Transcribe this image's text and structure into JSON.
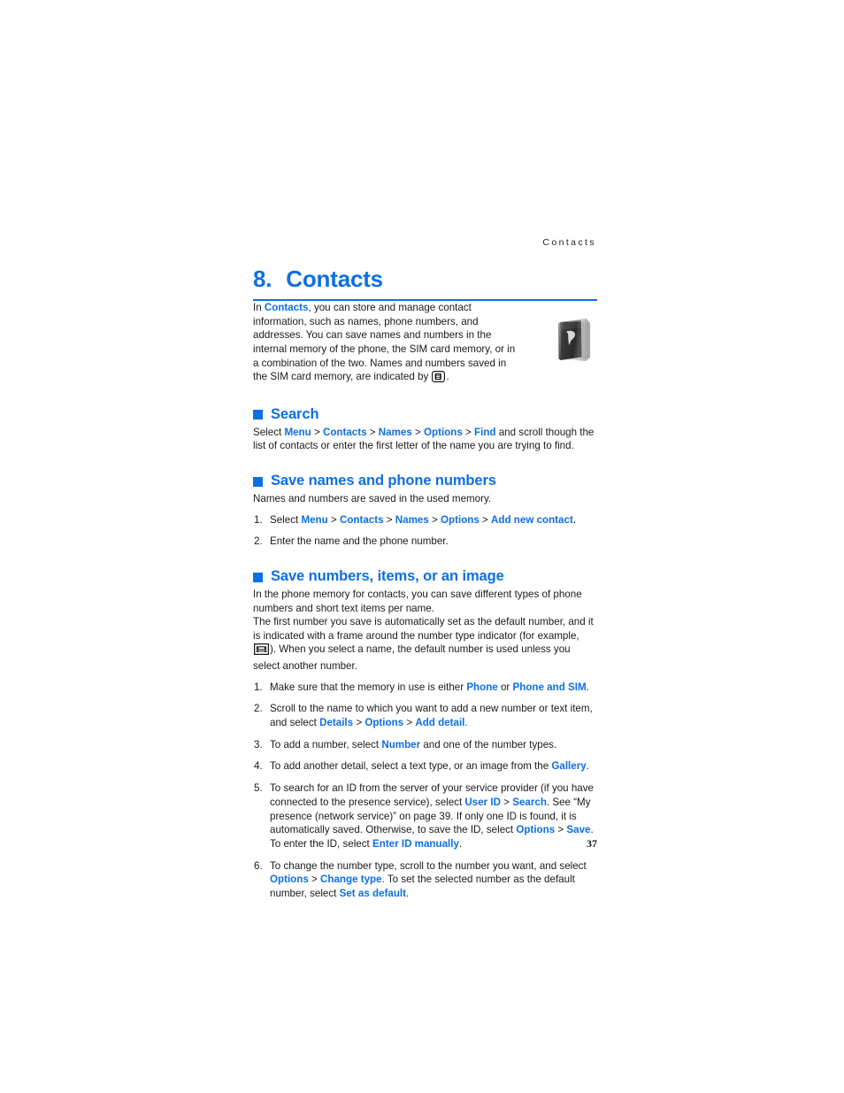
{
  "page": {
    "running_header": "Contacts",
    "page_number": "37",
    "accent_color": "#0d6fe3",
    "text_color": "#1a1a1a"
  },
  "chapter": {
    "number": "8.",
    "title": "Contacts"
  },
  "intro": {
    "segments": [
      {
        "t": "In ",
        "s": "plain"
      },
      {
        "t": "Contacts",
        "s": "blue"
      },
      {
        "t": ", you can store and manage contact information, such as names, phone numbers, and addresses. You can save names and numbers in the internal memory of the phone, the SIM card memory, or in a combination of the two. Names and numbers saved in the SIM card memory, are indicated by ",
        "s": "plain"
      },
      {
        "t": "sim-card-icon",
        "s": "icon"
      },
      {
        "t": ".",
        "s": "plain"
      }
    ],
    "illustration": "contacts-book-icon"
  },
  "sections": [
    {
      "id": "search",
      "heading": "Search",
      "paragraphs": [
        {
          "segments": [
            {
              "t": "Select ",
              "s": "plain"
            },
            {
              "t": "Menu",
              "s": "blue"
            },
            {
              "t": " > ",
              "s": "gt"
            },
            {
              "t": "Contacts",
              "s": "blue"
            },
            {
              "t": " > ",
              "s": "gt"
            },
            {
              "t": "Names",
              "s": "blue"
            },
            {
              "t": " > ",
              "s": "gt"
            },
            {
              "t": "Options",
              "s": "blue"
            },
            {
              "t": " > ",
              "s": "gt"
            },
            {
              "t": "Find",
              "s": "blue"
            },
            {
              "t": " and scroll though the list of contacts or enter the first letter of the name you are trying to find.",
              "s": "plain"
            }
          ]
        }
      ],
      "steps": []
    },
    {
      "id": "save-names-and-phone-numbers",
      "heading": "Save names and phone numbers",
      "paragraphs": [
        {
          "segments": [
            {
              "t": "Names and numbers are saved in the used memory.",
              "s": "plain"
            }
          ]
        }
      ],
      "steps": [
        {
          "num": "1.",
          "segments": [
            {
              "t": "Select ",
              "s": "plain"
            },
            {
              "t": "Menu",
              "s": "blue"
            },
            {
              "t": " > ",
              "s": "gt"
            },
            {
              "t": "Contacts",
              "s": "blue"
            },
            {
              "t": " > ",
              "s": "gt"
            },
            {
              "t": "Names",
              "s": "blue"
            },
            {
              "t": " > ",
              "s": "gt"
            },
            {
              "t": "Options",
              "s": "blue"
            },
            {
              "t": " > ",
              "s": "gt"
            },
            {
              "t": "Add new contact",
              "s": "blue"
            },
            {
              "t": ".",
              "s": "plain"
            }
          ]
        },
        {
          "num": "2.",
          "segments": [
            {
              "t": "Enter the name and the phone number.",
              "s": "plain"
            }
          ]
        }
      ]
    },
    {
      "id": "save-numbers-items-or-an-image",
      "heading": "Save numbers, items, or an image",
      "paragraphs": [
        {
          "segments": [
            {
              "t": "In the phone memory for contacts, you can save different types of phone numbers and short text items per name.",
              "s": "plain"
            }
          ]
        },
        {
          "segments": [
            {
              "t": "The first number you save is automatically set as the default number, and it is indicated with a frame around the number type indicator (for example, ",
              "s": "plain"
            },
            {
              "t": "default-phone-number-icon",
              "s": "icon"
            },
            {
              "t": "). When you select a name, the default number is used unless you select another number.",
              "s": "plain"
            }
          ]
        }
      ],
      "steps": [
        {
          "num": "1.",
          "segments": [
            {
              "t": "Make sure that the memory in use is either ",
              "s": "plain"
            },
            {
              "t": "Phone",
              "s": "blue"
            },
            {
              "t": " or ",
              "s": "plain"
            },
            {
              "t": "Phone and SIM",
              "s": "blue"
            },
            {
              "t": ".",
              "s": "plain"
            }
          ]
        },
        {
          "num": "2.",
          "segments": [
            {
              "t": "Scroll to the name to which you want to add a new number or text item, and select ",
              "s": "plain"
            },
            {
              "t": "Details",
              "s": "blue"
            },
            {
              "t": " > ",
              "s": "gt"
            },
            {
              "t": "Options",
              "s": "blue"
            },
            {
              "t": " > ",
              "s": "gt"
            },
            {
              "t": "Add detail",
              "s": "blue"
            },
            {
              "t": ".",
              "s": "plain"
            }
          ]
        },
        {
          "num": "3.",
          "segments": [
            {
              "t": "To add a number, select ",
              "s": "plain"
            },
            {
              "t": "Number",
              "s": "blue"
            },
            {
              "t": " and one of the number types.",
              "s": "plain"
            }
          ]
        },
        {
          "num": "4.",
          "segments": [
            {
              "t": "To add another detail, select a text type, or an image from the ",
              "s": "plain"
            },
            {
              "t": "Gallery",
              "s": "blue"
            },
            {
              "t": ".",
              "s": "plain"
            }
          ]
        },
        {
          "num": "5.",
          "segments": [
            {
              "t": "To search for an ID from the server of your service provider (if you have connected to the presence service), select ",
              "s": "plain"
            },
            {
              "t": "User ID",
              "s": "blue"
            },
            {
              "t": " > ",
              "s": "gt"
            },
            {
              "t": "Search",
              "s": "blue"
            },
            {
              "t": ". See “My presence (network service)” on page 39. If only one ID is found, it is automatically saved. Otherwise, to save the ID, select ",
              "s": "plain"
            },
            {
              "t": "Options",
              "s": "blue"
            },
            {
              "t": " > ",
              "s": "gt"
            },
            {
              "t": "Save",
              "s": "blue"
            },
            {
              "t": ". To enter the ID, select ",
              "s": "plain"
            },
            {
              "t": "Enter ID manually",
              "s": "blue"
            },
            {
              "t": ".",
              "s": "plain"
            }
          ]
        },
        {
          "num": "6.",
          "segments": [
            {
              "t": "To change the number type, scroll to the number you want, and select ",
              "s": "plain"
            },
            {
              "t": "Options",
              "s": "blue"
            },
            {
              "t": " > ",
              "s": "gt"
            },
            {
              "t": "Change type",
              "s": "blue"
            },
            {
              "t": ". To set the selected number as the default number, select ",
              "s": "plain"
            },
            {
              "t": "Set as default",
              "s": "blue"
            },
            {
              "t": ".",
              "s": "plain"
            }
          ]
        }
      ]
    }
  ]
}
